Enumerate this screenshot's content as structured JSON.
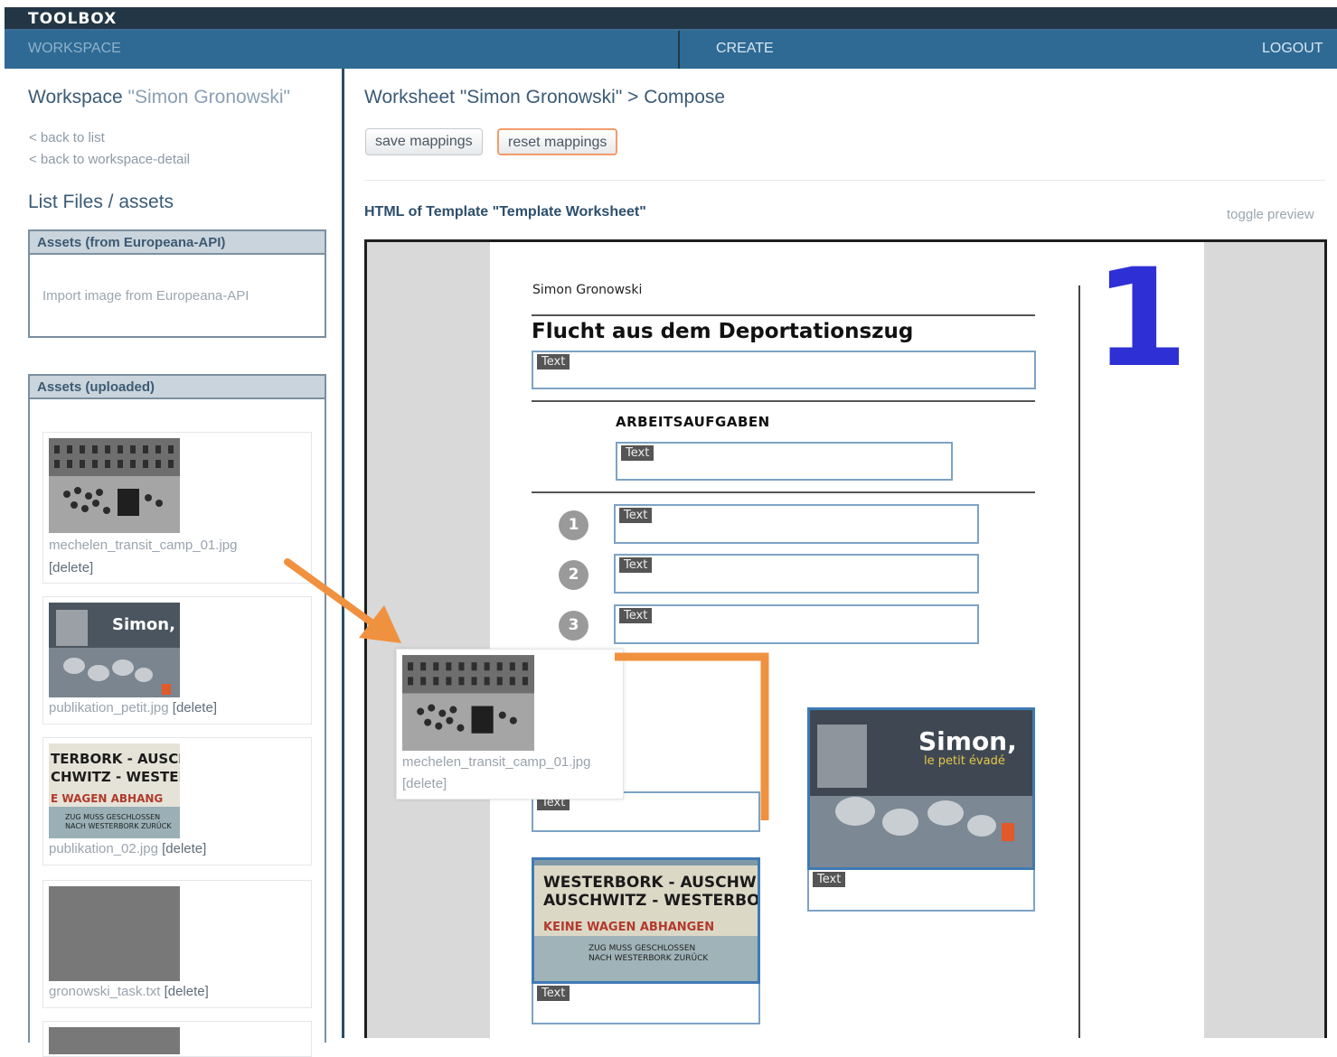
{
  "header": {
    "app_title": "TOOLBOX",
    "nav": {
      "workspace": "WORKSPACE",
      "create": "CREATE",
      "logout": "LOGOUT"
    }
  },
  "sidebar": {
    "workspace_label": "Workspace",
    "workspace_name": "\"Simon Gronowski\"",
    "back_to_list": "< back to list",
    "back_to_detail": "< back to workspace-detail",
    "list_files_title": "List Files / assets",
    "europeana_panel": {
      "title": "Assets (from Europeana-API)",
      "import_link": "Import image from Europeana-API"
    },
    "uploaded_panel": {
      "title": "Assets (uploaded)",
      "delete_label": "[delete]",
      "assets": [
        {
          "filename": "mechelen_transit_camp_01.jpg"
        },
        {
          "filename": "publikation_petit.jpg"
        },
        {
          "filename": "publikation_02.jpg"
        },
        {
          "filename": "gronowski_task.txt"
        }
      ]
    }
  },
  "main": {
    "title": "Worksheet \"Simon Gronowski\" > Compose",
    "buttons": {
      "save": "save mappings",
      "reset": "reset mappings"
    },
    "template_label": "HTML of Template \"Template Worksheet\"",
    "toggle_preview": "toggle preview",
    "worksheet": {
      "author": "Simon Gronowski",
      "heading": "Flucht aus dem Deportationszug",
      "section_title": "ARBEITSAUFGABEN",
      "page_number": "1",
      "text_tag": "Text",
      "task_numbers": [
        "1",
        "2",
        "3"
      ],
      "poster_image_text": {
        "line1": "WESTERBORK - AUSCHWITZ",
        "line2": "AUSCHWITZ - WESTERBORK",
        "line3": "KEINE WAGEN ABHANGEN",
        "line4": "ZUG MUSS GESCHLOSSEN",
        "line5": "NACH WESTERBORK ZURÜCK"
      },
      "book_cover_text": {
        "title": "Simon,",
        "subtitle": "le petit évadé"
      }
    },
    "drag_ghost": {
      "filename": "mechelen_transit_camp_01.jpg",
      "delete_label": "[delete]"
    }
  },
  "colors": {
    "nav_bar": "#2e6a94",
    "toolbox_bar": "#233645",
    "page_number": "#2f2fd6",
    "annotation_arrow": "#f0913f",
    "text_box_border": "#7ca3c5"
  },
  "icons": [
    "number-circle-icon"
  ]
}
